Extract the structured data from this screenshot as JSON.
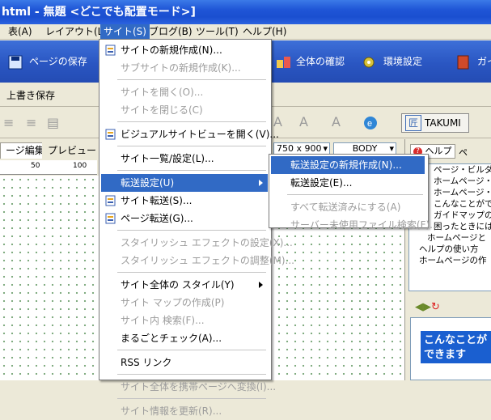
{
  "window": {
    "title": "html - 無題 <どこでも配置モード>]"
  },
  "menubar": [
    {
      "label": "表(A)"
    },
    {
      "label": "レイアウト(L)"
    },
    {
      "label": "サイト(S)"
    },
    {
      "label": "ブログ(B)"
    },
    {
      "label": "ツール(T)"
    },
    {
      "label": "ヘルプ(H)"
    }
  ],
  "toolbar": {
    "page_save": "ページの保存",
    "check_all": "全体の確認",
    "env_settings": "環境設定",
    "guide": "ガイ",
    "overwrite_save": "上書き保存",
    "size_select": "750 x 900",
    "element_select": "BODY",
    "takumi": "TAKUMI"
  },
  "tabs": {
    "page_edit": "ージ編集",
    "preview": "プレビュー"
  },
  "ruler": {
    "mark_50": "50",
    "mark_100": "100"
  },
  "help_panel": {
    "tab_help": "ヘルプ",
    "tab_page": "ペ",
    "tree": [
      "ページ・ビルダー",
      "ホームページ・ビル",
      "ホームページ・",
      "こんなことがで",
      "ガイドマップの(",
      "困ったときには",
      "ホームページと",
      "ヘルプの使い方",
      "ホームページの作"
    ],
    "banner": "こんなことが\nできます"
  },
  "site_menu": {
    "items": [
      {
        "label": "サイトの新規作成(N)...",
        "disabled": false,
        "icon": "new-site-icon"
      },
      {
        "label": "サブサイトの新規作成(K)...",
        "disabled": true
      },
      {
        "sep": true
      },
      {
        "label": "サイトを開く(O)...",
        "disabled": true
      },
      {
        "label": "サイトを閉じる(C)",
        "disabled": true
      },
      {
        "sep": true
      },
      {
        "label": "ビジュアルサイトビューを開く(V)...",
        "disabled": false,
        "icon": "site-view-icon"
      },
      {
        "sep": true
      },
      {
        "label": "サイト一覧/設定(L)...",
        "disabled": false
      },
      {
        "sep": true
      },
      {
        "label": "転送設定(U)",
        "disabled": false,
        "submenu": true,
        "highlight": true
      },
      {
        "label": "サイト転送(S)...",
        "disabled": false,
        "icon": "site-transfer-icon"
      },
      {
        "label": "ページ転送(G)...",
        "disabled": false,
        "icon": "page-transfer-icon"
      },
      {
        "sep": true
      },
      {
        "label": "スタイリッシュ エフェクトの設定(X)...",
        "disabled": true
      },
      {
        "label": "スタイリッシュ エフェクトの調整(M)...",
        "disabled": true
      },
      {
        "sep": true
      },
      {
        "label": "サイト全体の スタイル(Y)",
        "disabled": false,
        "submenu": true
      },
      {
        "label": "サイト マップの作成(P)",
        "disabled": true
      },
      {
        "label": "サイト内 検索(F)...",
        "disabled": true
      },
      {
        "label": "まるごとチェック(A)...",
        "disabled": false
      },
      {
        "sep": true
      },
      {
        "label": "RSS リンク",
        "disabled": false
      },
      {
        "sep": true
      },
      {
        "label": "サイト全体を携帯ページへ変換(I)...",
        "disabled": true
      },
      {
        "sep": true
      },
      {
        "label": "サイト情報を更新(R)...",
        "disabled": true
      }
    ]
  },
  "transfer_submenu": {
    "items": [
      {
        "label": "転送設定の新規作成(N)...",
        "disabled": false,
        "highlight": true
      },
      {
        "label": "転送設定(E)...",
        "disabled": false
      },
      {
        "sep": true
      },
      {
        "label": "すべて転送済みにする(A)",
        "disabled": true
      },
      {
        "label": "サーバー未使用ファイル検索(F)...",
        "disabled": true
      }
    ]
  }
}
